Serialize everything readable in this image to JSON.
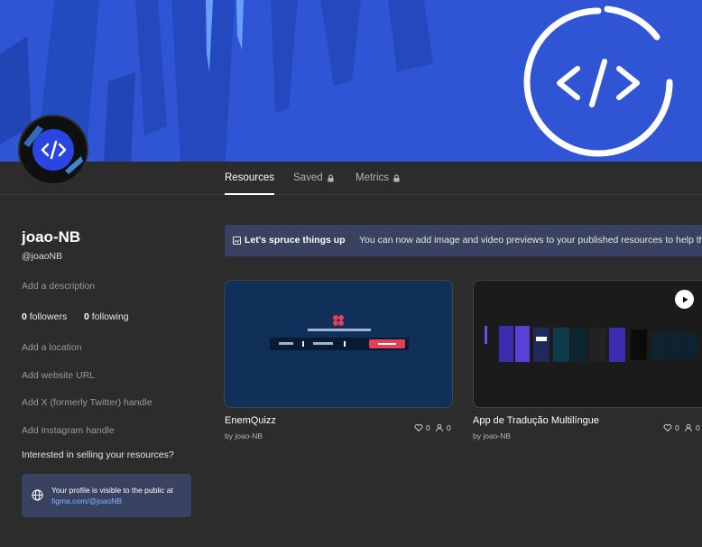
{
  "colors": {
    "banner": "#2f55d4",
    "background": "#2c2c2c",
    "accent_link": "#7fb5ff",
    "promo_bg": "#3a4262"
  },
  "banner": {
    "logo_glyph": "</>",
    "logo_icon": "code-brackets-icon"
  },
  "tabs": [
    {
      "label": "Resources",
      "active": true,
      "locked": false
    },
    {
      "label": "Saved",
      "active": false,
      "locked": true
    },
    {
      "label": "Metrics",
      "active": false,
      "locked": true
    }
  ],
  "profile": {
    "name": "joao-NB",
    "handle": "@joaoNB",
    "add_description": "Add a description",
    "followers_count": "0",
    "followers_label": " followers",
    "following_count": "0",
    "following_label": " following",
    "add_location": "Add a location",
    "add_website": "Add website URL",
    "add_x": "Add X (formerly Twitter) handle",
    "add_instagram": "Add Instagram handle",
    "sell_prompt": "Interested in selling your resources?"
  },
  "visibility": {
    "text": "Your profile is visible to the public at",
    "link": "figma.com/@joaoNB"
  },
  "promo": {
    "title": "Let's spruce things up",
    "message": "You can now add image and video previews to your published resources to help them stand out"
  },
  "cards": [
    {
      "title": "EnemQuizz",
      "author": "by joao-NB",
      "likes": "0",
      "users": "0",
      "has_video": false
    },
    {
      "title": "App de Tradução Multilíngue",
      "author": "by joao-NB",
      "likes": "0",
      "users": "0",
      "has_video": true
    }
  ]
}
